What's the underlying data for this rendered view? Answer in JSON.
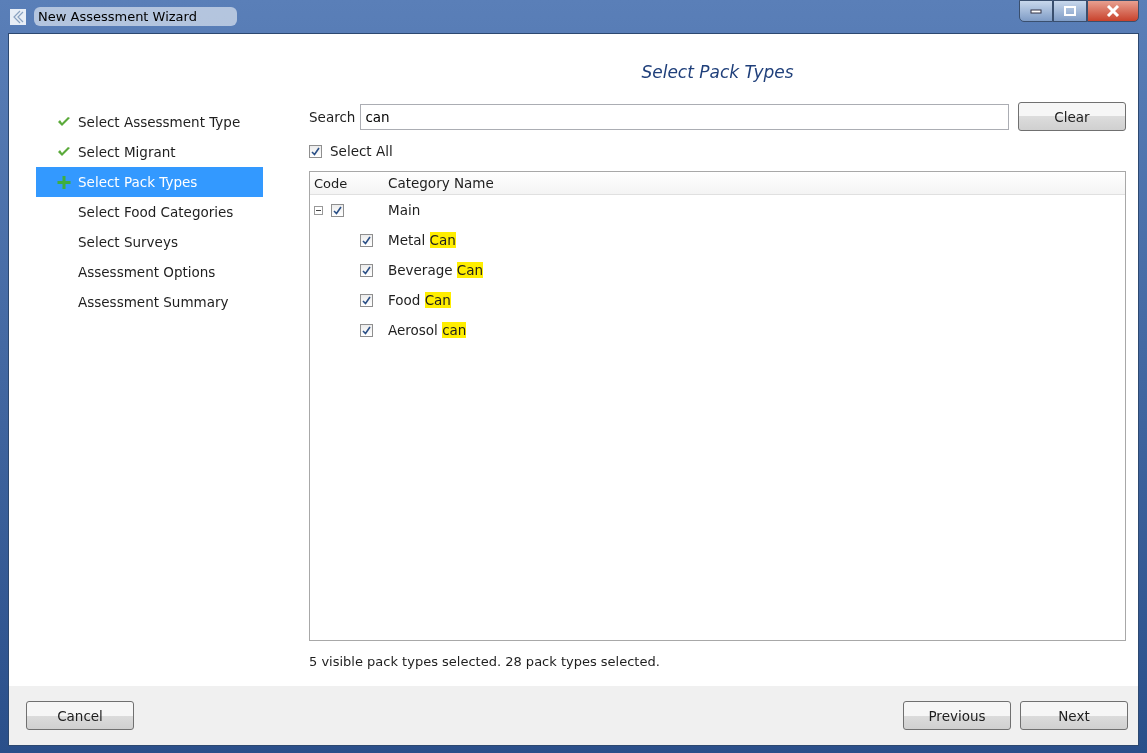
{
  "window": {
    "title": "New Assessment Wizard"
  },
  "steps": [
    {
      "label": "Select Assessment Type",
      "kind": "done",
      "selected": false
    },
    {
      "label": "Select Migrant",
      "kind": "done",
      "selected": false
    },
    {
      "label": "Select Pack Types",
      "kind": "current",
      "selected": true
    },
    {
      "label": "Select Food Categories",
      "kind": "pending",
      "selected": false
    },
    {
      "label": "Select Surveys",
      "kind": "pending",
      "selected": false
    },
    {
      "label": "Assessment Options",
      "kind": "pending",
      "selected": false
    },
    {
      "label": "Assessment Summary",
      "kind": "pending",
      "selected": false
    }
  ],
  "heading": "Select Pack Types",
  "search": {
    "label": "Search",
    "value": "can"
  },
  "clear_button": {
    "label": "Clear"
  },
  "select_all": {
    "label": "Select All",
    "checked": true
  },
  "table": {
    "columns": [
      "Code",
      "Category Name"
    ],
    "rows": [
      {
        "name": "Main",
        "checked": true,
        "expanded": true,
        "children": [
          {
            "name": "Metal",
            "match": "Can",
            "checked": true
          },
          {
            "name": "Beverage",
            "match": "Can",
            "checked": true
          },
          {
            "name": "Food",
            "match": "Can",
            "checked": true
          },
          {
            "name": "Aerosol",
            "match": "can",
            "checked": true
          }
        ]
      }
    ]
  },
  "status": "5 visible pack types selected. 28 pack types selected.",
  "buttons": {
    "cancel": {
      "label": "Cancel"
    },
    "previous": {
      "label": "Previous"
    },
    "next": {
      "label": "Next"
    }
  }
}
